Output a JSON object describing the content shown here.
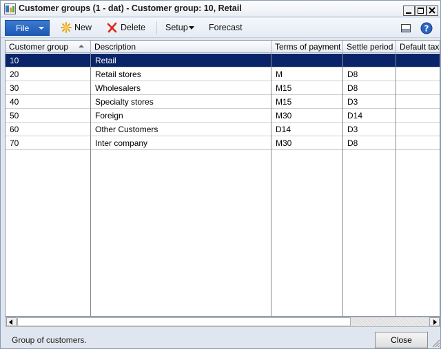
{
  "window": {
    "title": "Customer groups (1 - dat) - Customer group: 10, Retail"
  },
  "toolbar": {
    "file_label": "File",
    "new_label": "New",
    "delete_label": "Delete",
    "setup_label": "Setup",
    "forecast_label": "Forecast"
  },
  "grid": {
    "columns": [
      "Customer group",
      "Description",
      "Terms of payment",
      "Settle period",
      "Default tax"
    ],
    "rows": [
      [
        "10",
        "Retail",
        "",
        "",
        ""
      ],
      [
        "20",
        "Retail stores",
        "M",
        "D8",
        ""
      ],
      [
        "30",
        "Wholesalers",
        "M15",
        "D8",
        ""
      ],
      [
        "40",
        "Specialty stores",
        "M15",
        "D3",
        ""
      ],
      [
        "50",
        "Foreign",
        "M30",
        "D14",
        ""
      ],
      [
        "60",
        "Other Customers",
        "D14",
        "D3",
        ""
      ],
      [
        "70",
        "Inter company",
        "M30",
        "D8",
        ""
      ]
    ],
    "selected_row": 0,
    "sort_column": "Customer group"
  },
  "status": {
    "text": "Group of customers.",
    "close_label": "Close"
  },
  "colors": {
    "selection": "#0a246a",
    "file_button": "#1b59b6"
  }
}
